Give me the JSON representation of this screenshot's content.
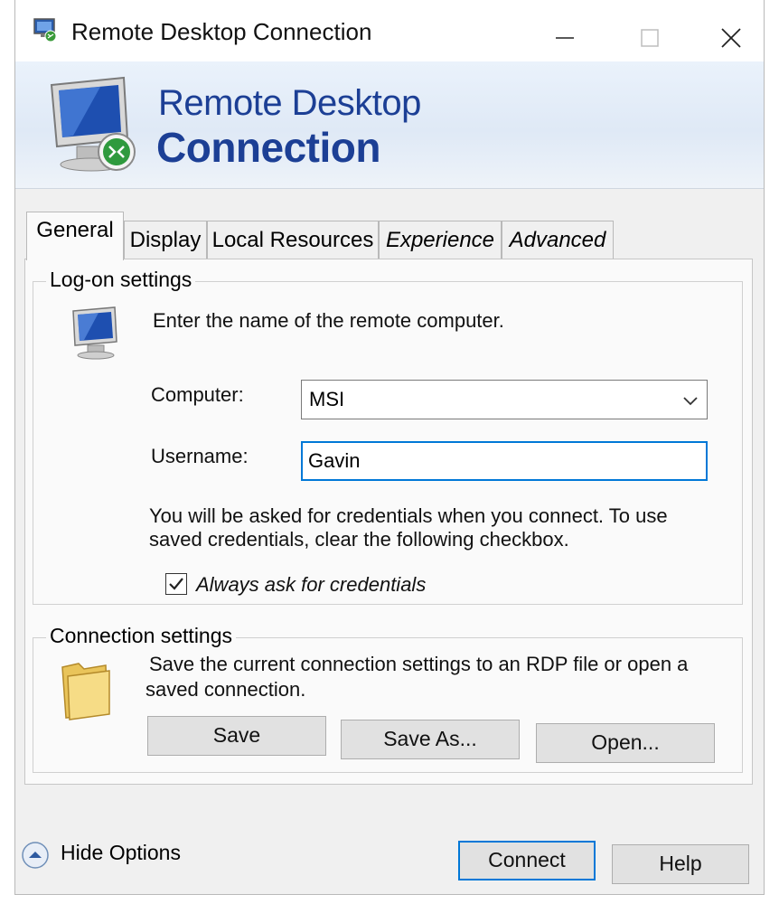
{
  "window": {
    "title": "Remote Desktop Connection",
    "icon": "rdp-monitor-icon"
  },
  "banner": {
    "line1": "Remote Desktop",
    "line2": "Connection"
  },
  "tabs": [
    {
      "label": "General",
      "active": true
    },
    {
      "label": "Display",
      "active": false
    },
    {
      "label": "Local Resources",
      "active": false
    },
    {
      "label": "Experience",
      "active": false
    },
    {
      "label": "Advanced",
      "active": false
    }
  ],
  "logon": {
    "title": "Log-on settings",
    "instruction": "Enter the name of the remote computer.",
    "computer_label": "Computer:",
    "computer_value": "MSI",
    "username_label": "Username:",
    "username_value": "Gavin",
    "credentials_line1": "You will be asked for credentials when you connect. To use",
    "credentials_line2": "saved credentials, clear the following checkbox.",
    "always_ask_label": "Always ask for credentials",
    "always_ask_checked": true
  },
  "connection": {
    "title": "Connection settings",
    "desc_line1": "Save the current connection settings to an RDP file or open a",
    "desc_line2": "saved connection.",
    "save_label": "Save",
    "save_as_label": "Save As...",
    "open_label": "Open..."
  },
  "footer": {
    "hide_options_label": "Hide Options",
    "connect_label": "Connect",
    "help_label": "Help"
  },
  "colors": {
    "accent": "#0078d7",
    "banner_text": "#1c3f95"
  }
}
